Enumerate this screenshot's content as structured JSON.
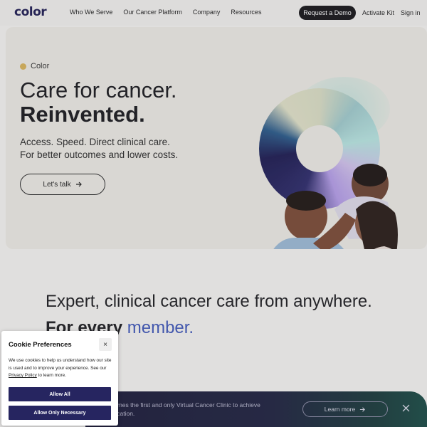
{
  "nav": {
    "logo": "color",
    "links": [
      "Who We Serve",
      "Our Cancer Platform",
      "Company",
      "Resources"
    ],
    "request_demo": "Request a Demo",
    "activate_kit": "Activate Kit",
    "sign_in": "Sign in"
  },
  "hero": {
    "brand_tag": "Color",
    "title_line1": "Care for cancer.",
    "title_line2": "Reinvented.",
    "sub_line1": "Access. Speed. Direct clinical care.",
    "sub_line2": "For better outcomes and lower costs.",
    "cta": "Let's talk",
    "cta_icon": "arrow-right-icon"
  },
  "section2": {
    "line1": "Expert, clinical cancer care from anywhere.",
    "line2_part1": "For every",
    "line2_accent": "member."
  },
  "banner": {
    "text_line1": "omes the first and only Virtual Cancer Clinic to achieve",
    "text_line2": "fication.",
    "cta": "Learn more",
    "close_icon": "close-icon"
  },
  "cookie": {
    "title": "Cookie Preferences",
    "close": "×",
    "body_pre": "We use cookies to help us understand how our site is used and to improve your experience. See our ",
    "body_link": "Privacy Policy",
    "body_post": " to learn more.",
    "allow_all": "Allow All",
    "allow_necessary": "Allow Only Necessary"
  },
  "colors": {
    "accent": "#3f57b8",
    "brand_navy": "#262560",
    "tag_dot": "#d7b25a"
  }
}
